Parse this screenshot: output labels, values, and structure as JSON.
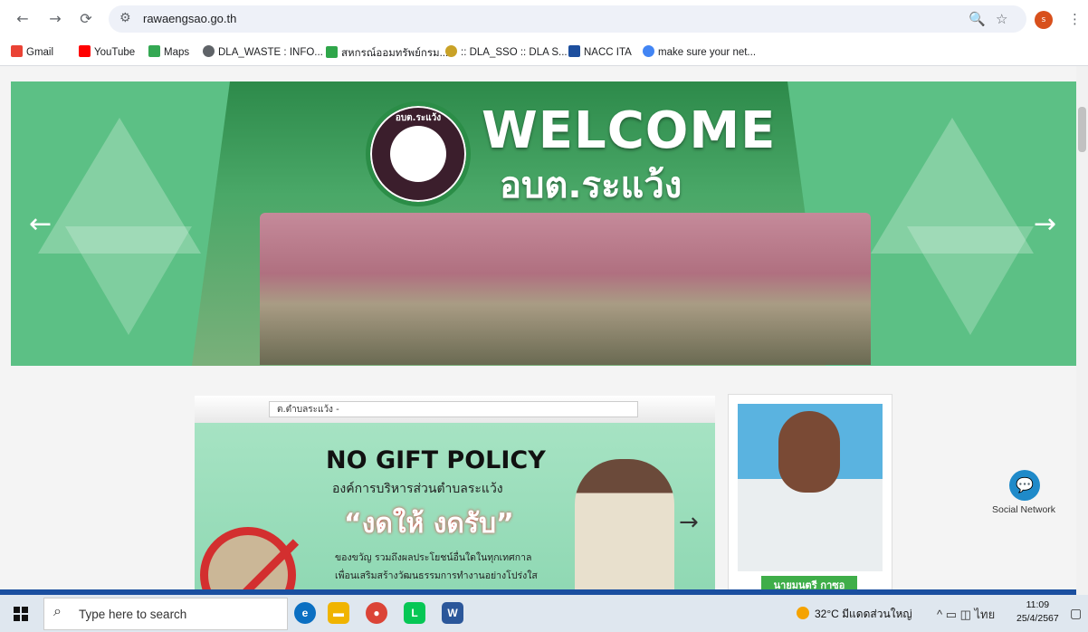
{
  "browser": {
    "url": "rawaengsao.go.th",
    "profile_initial": "s"
  },
  "bookmarks": [
    {
      "label": "Gmail",
      "icon": "gmail-icon",
      "color": "#ea4335"
    },
    {
      "label": "YouTube",
      "icon": "youtube-icon",
      "color": "#ff0000"
    },
    {
      "label": "Maps",
      "icon": "maps-icon",
      "color": "#34a853"
    },
    {
      "label": "DLA_WASTE : INFO...",
      "icon": "globe-icon",
      "color": "#5f6368"
    },
    {
      "label": "สหกรณ์ออมทรัพย์กรม...",
      "icon": "wifi-icon",
      "color": "#2fa64a"
    },
    {
      "label": ":: DLA_SSO :: DLA S...",
      "icon": "dla-logo-icon",
      "color": "#c9a227"
    },
    {
      "label": "NACC ITA",
      "icon": "ita-icon",
      "color": "#1d4f9e"
    },
    {
      "label": "make sure your net...",
      "icon": "google-icon",
      "color": "#4285f4"
    }
  ],
  "hero": {
    "welcome": "WELCOME",
    "org_short": "อบต.ระแว้ง",
    "seal_label": "อบต.ระแว้ง",
    "prev_arrow": "←",
    "next_arrow": "→"
  },
  "banner": {
    "select_value": "ต.ตำบลระแว้ง -",
    "title": "NO GIFT POLICY",
    "subtitle": "องค์การบริหารส่วนตำบลระแว้ง",
    "slogan": "“งดให้ งดรับ”",
    "line1": "ของขวัญ รวมถึงผลประโยชน์อื่นใดในทุกเทศกาล",
    "line2": "เพื่อนเสริมสร้างวัฒนธรรมการทำงานอย่างโปร่งใส",
    "next_arrow": "→"
  },
  "profile": {
    "name": "นายมนตรี กาซอ"
  },
  "social": {
    "label": "Social Network"
  },
  "taskbar": {
    "search_placeholder": "Type here to search",
    "weather": "32°C มีแดดส่วนใหญ่",
    "lang": "ไทย",
    "time": "11:09",
    "date": "25/4/2567"
  },
  "colors": {
    "accent_green": "#3fae49",
    "hero_green": "#5cc085",
    "link_blue": "#1f8ac9"
  }
}
